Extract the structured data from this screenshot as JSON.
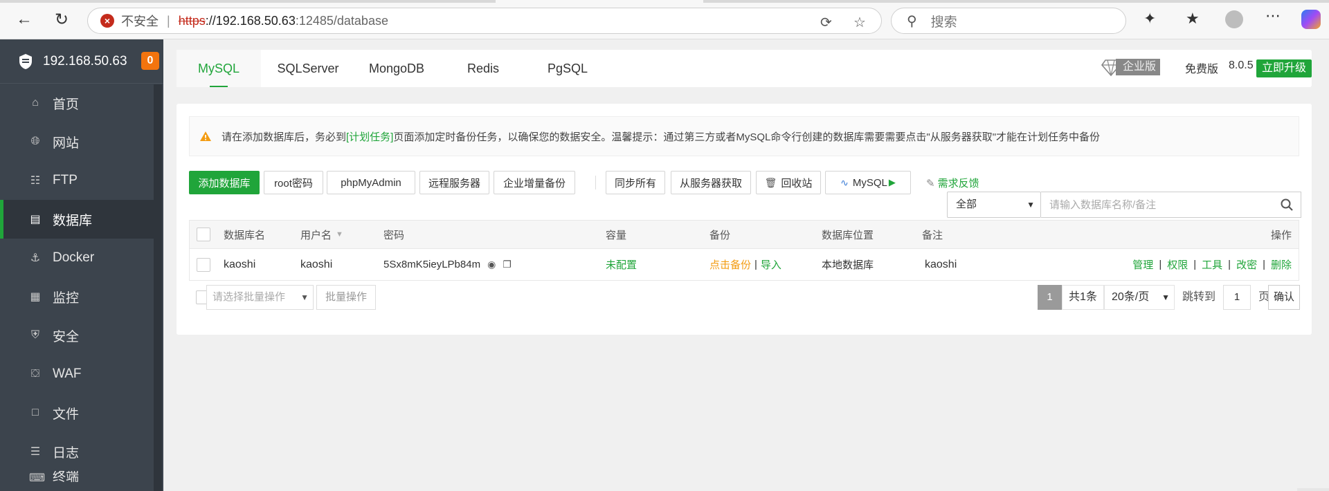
{
  "browser": {
    "insecure_label": "不安全",
    "url_scheme": "https",
    "url_host": "://192.168.50.63",
    "url_path": ":12485/database",
    "search_placeholder": "搜索"
  },
  "sidebar": {
    "server": "192.168.50.63",
    "badge": "0",
    "items": [
      {
        "label": "首页"
      },
      {
        "label": "网站"
      },
      {
        "label": "FTP"
      },
      {
        "label": "数据库"
      },
      {
        "label": "Docker"
      },
      {
        "label": "监控"
      },
      {
        "label": "安全"
      },
      {
        "label": "WAF"
      },
      {
        "label": "文件"
      },
      {
        "label": "日志"
      },
      {
        "label": "终端"
      }
    ]
  },
  "tabs": [
    {
      "label": "MySQL"
    },
    {
      "label": "SQLServer"
    },
    {
      "label": "MongoDB"
    },
    {
      "label": "Redis"
    },
    {
      "label": "PgSQL"
    }
  ],
  "version": {
    "enterprise": "企业版",
    "free": "免费版",
    "number": "8.0.5",
    "upgrade": "立即升级"
  },
  "alert": {
    "before": "请在添加数据库后，务必到",
    "link": "[计划任务]",
    "after": "页面添加定时备份任务，以确保您的数据安全。温馨提示：通过第三方或者MySQL命令行创建的数据库需要需要点击\"从服务器获取\"才能在计划任务中备份"
  },
  "toolbar": {
    "add_db": "添加数据库",
    "root_pwd": "root密码",
    "phpmyadmin": "phpMyAdmin",
    "remote": "远程服务器",
    "incr_backup": "企业增量备份",
    "sync_all": "同步所有",
    "fetch_server": "从服务器获取",
    "recycle": "回收站",
    "mysql": "MySQL",
    "feedback": "需求反馈",
    "filter": "全部",
    "search_placeholder": "请输入数据库名称/备注"
  },
  "table": {
    "headers": {
      "name": "数据库名",
      "user": "用户名",
      "password": "密码",
      "capacity": "容量",
      "backup": "备份",
      "location": "数据库位置",
      "note": "备注",
      "ops": "操作"
    },
    "rows": [
      {
        "name": "kaoshi",
        "user": "kaoshi",
        "password": "5Sx8mK5ieyLPb84m",
        "capacity": "未配置",
        "backup_action": "点击备份",
        "import_action": "导入",
        "location": "本地数据库",
        "note": "kaoshi",
        "ops": [
          "管理",
          "权限",
          "工具",
          "改密",
          "删除"
        ]
      }
    ]
  },
  "footer": {
    "batch_placeholder": "请选择批量操作",
    "batch_button": "批量操作",
    "current_page": "1",
    "total": "共1条",
    "page_size": "20条/页",
    "jump_label": "跳转到",
    "jump_value": "1",
    "page_unit": "页",
    "confirm": "确认"
  },
  "colors": {
    "accent": "#20a53a",
    "sidebar_bg": "#3c444d",
    "warning": "#f39c12",
    "badge": "#f3740e"
  }
}
